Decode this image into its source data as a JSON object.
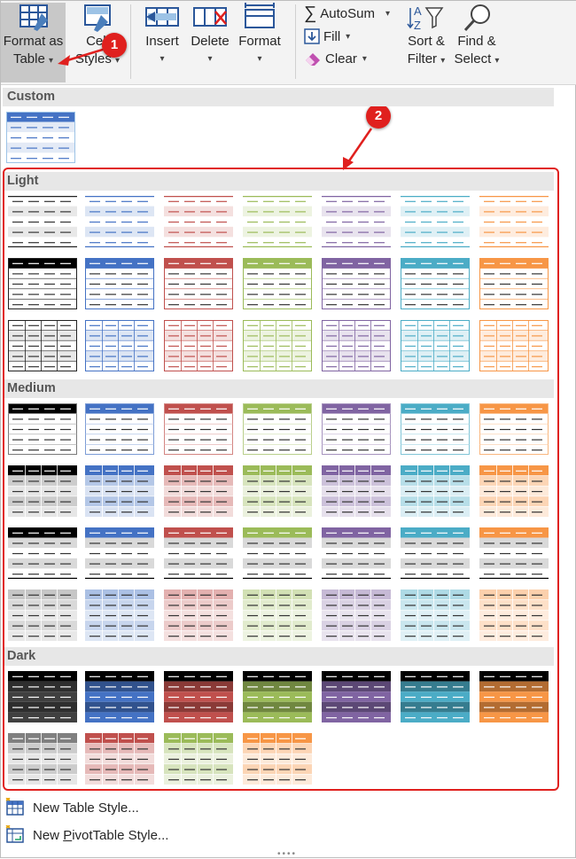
{
  "ribbon": {
    "format_as_table": {
      "line1": "Format as",
      "line2": "Table",
      "icon": "format-as-table-icon"
    },
    "cell_styles": {
      "line1": "Cell",
      "line2": "Styles",
      "icon": "cell-styles-icon"
    },
    "insert": {
      "label": "Insert",
      "icon": "insert-cells-icon"
    },
    "delete": {
      "label": "Delete",
      "icon": "delete-cells-icon"
    },
    "format": {
      "label": "Format",
      "icon": "format-cells-icon"
    },
    "autosum": {
      "label": "AutoSum",
      "icon": "sigma-icon"
    },
    "fill": {
      "label": "Fill",
      "icon": "fill-down-icon"
    },
    "clear": {
      "label": "Clear",
      "icon": "eraser-icon"
    },
    "sort_filter": {
      "line1": "Sort &",
      "line2": "Filter",
      "icon": "sort-filter-icon"
    },
    "find_select": {
      "line1": "Find &",
      "line2": "Select",
      "icon": "magnifier-icon"
    }
  },
  "callouts": {
    "one": "1",
    "two": "2"
  },
  "gallery": {
    "sections": [
      {
        "title": "Custom",
        "rows": [
          [
            {
              "type": "custom",
              "color": "#4472C4"
            }
          ]
        ]
      },
      {
        "title": "Light",
        "rows": [
          [
            {
              "type": "l1",
              "color": "#000000"
            },
            {
              "type": "l1",
              "color": "#4472C4"
            },
            {
              "type": "l1",
              "color": "#C0504D"
            },
            {
              "type": "l1",
              "color": "#9BBB59"
            },
            {
              "type": "l1",
              "color": "#8064A2"
            },
            {
              "type": "l1",
              "color": "#4BACC6"
            },
            {
              "type": "l1",
              "color": "#F79646"
            }
          ],
          [
            {
              "type": "l2",
              "color": "#000000"
            },
            {
              "type": "l2",
              "color": "#4472C4"
            },
            {
              "type": "l2",
              "color": "#C0504D"
            },
            {
              "type": "l2",
              "color": "#9BBB59"
            },
            {
              "type": "l2",
              "color": "#8064A2"
            },
            {
              "type": "l2",
              "color": "#4BACC6"
            },
            {
              "type": "l2",
              "color": "#F79646"
            }
          ],
          [
            {
              "type": "l3",
              "color": "#000000"
            },
            {
              "type": "l3",
              "color": "#4472C4"
            },
            {
              "type": "l3",
              "color": "#C0504D"
            },
            {
              "type": "l3",
              "color": "#9BBB59"
            },
            {
              "type": "l3",
              "color": "#8064A2"
            },
            {
              "type": "l3",
              "color": "#4BACC6"
            },
            {
              "type": "l3",
              "color": "#F79646"
            }
          ]
        ]
      },
      {
        "title": "Medium",
        "rows": [
          [
            {
              "type": "m1",
              "color": "#000000"
            },
            {
              "type": "m1",
              "color": "#4472C4"
            },
            {
              "type": "m1",
              "color": "#C0504D"
            },
            {
              "type": "m1",
              "color": "#9BBB59"
            },
            {
              "type": "m1",
              "color": "#8064A2"
            },
            {
              "type": "m1",
              "color": "#4BACC6"
            },
            {
              "type": "m1",
              "color": "#F79646"
            }
          ],
          [
            {
              "type": "m2",
              "color": "#000000"
            },
            {
              "type": "m2",
              "color": "#4472C4"
            },
            {
              "type": "m2",
              "color": "#C0504D"
            },
            {
              "type": "m2",
              "color": "#9BBB59"
            },
            {
              "type": "m2",
              "color": "#8064A2"
            },
            {
              "type": "m2",
              "color": "#4BACC6"
            },
            {
              "type": "m2",
              "color": "#F79646"
            }
          ],
          [
            {
              "type": "m3",
              "color": "#000000"
            },
            {
              "type": "m3",
              "color": "#4472C4"
            },
            {
              "type": "m3",
              "color": "#C0504D"
            },
            {
              "type": "m3",
              "color": "#9BBB59"
            },
            {
              "type": "m3",
              "color": "#8064A2"
            },
            {
              "type": "m3",
              "color": "#4BACC6"
            },
            {
              "type": "m3",
              "color": "#F79646"
            }
          ],
          [
            {
              "type": "m4",
              "color": "#000000"
            },
            {
              "type": "m4",
              "color": "#4472C4"
            },
            {
              "type": "m4",
              "color": "#C0504D"
            },
            {
              "type": "m4",
              "color": "#9BBB59"
            },
            {
              "type": "m4",
              "color": "#8064A2"
            },
            {
              "type": "m4",
              "color": "#4BACC6"
            },
            {
              "type": "m4",
              "color": "#F79646"
            }
          ]
        ]
      },
      {
        "title": "Dark",
        "rows": [
          [
            {
              "type": "d1",
              "color": "#404040"
            },
            {
              "type": "d1",
              "color": "#4472C4"
            },
            {
              "type": "d1",
              "color": "#C0504D"
            },
            {
              "type": "d1",
              "color": "#9BBB59"
            },
            {
              "type": "d1",
              "color": "#8064A2"
            },
            {
              "type": "d1",
              "color": "#4BACC6"
            },
            {
              "type": "d1",
              "color": "#F79646"
            }
          ],
          [
            {
              "type": "d2",
              "color": "#808080"
            },
            {
              "type": "d2",
              "color": "#C0504D"
            },
            {
              "type": "d2",
              "color": "#9BBB59"
            },
            {
              "type": "d2",
              "color": "#F79646"
            }
          ]
        ]
      }
    ]
  },
  "menu": {
    "new_table_style": {
      "text": "New Table Style...",
      "icon": "new-table-style-icon"
    },
    "new_pivot_style": {
      "before": "New ",
      "underline": "P",
      "after": "ivotTable Style...",
      "icon": "new-pivot-style-icon"
    }
  }
}
